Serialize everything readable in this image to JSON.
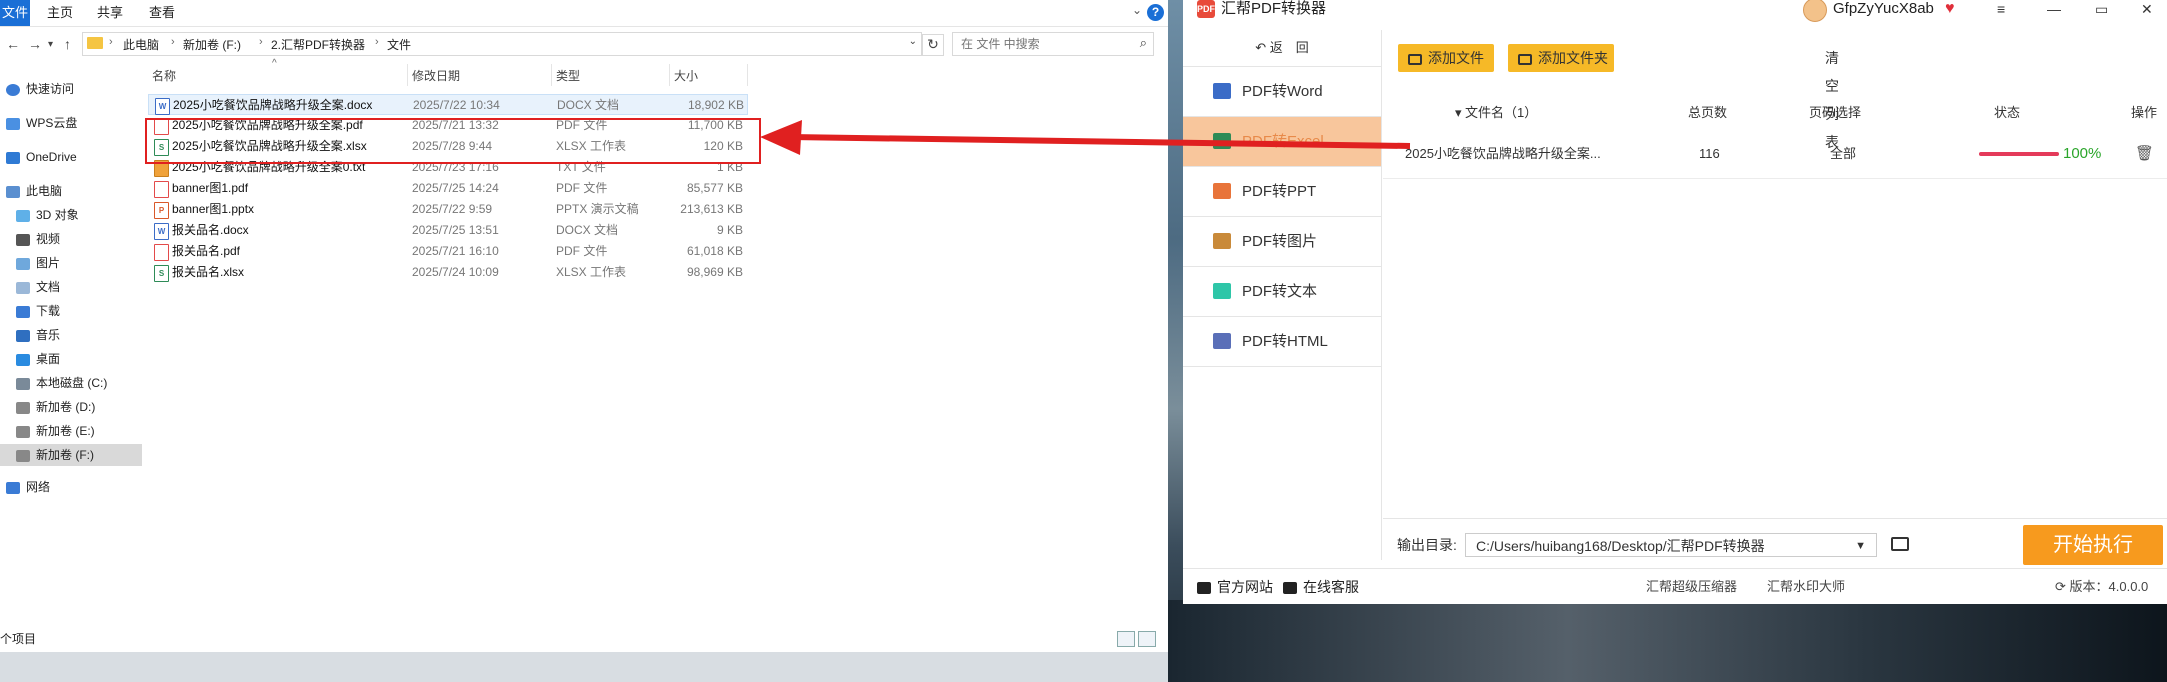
{
  "explorer": {
    "ribbon": {
      "file": "文件",
      "home": "主页",
      "share": "共享",
      "view": "查看"
    },
    "breadcrumbs": [
      "此电脑",
      "新加卷 (F:)",
      "2.汇帮PDF转换器",
      "文件"
    ],
    "search_placeholder": "在 文件 中搜索",
    "nav": {
      "quick_access": "快速访问",
      "wps_cloud": "WPS云盘",
      "onedrive": "OneDrive",
      "this_pc": "此电脑",
      "objects_3d": "3D 对象",
      "videos": "视频",
      "pictures": "图片",
      "documents": "文档",
      "downloads": "下载",
      "music": "音乐",
      "desktop": "桌面",
      "disk_c": "本地磁盘 (C:)",
      "disk_d": "新加卷 (D:)",
      "disk_e": "新加卷 (E:)",
      "disk_f": "新加卷 (F:)",
      "network": "网络"
    },
    "columns": {
      "name": "名称",
      "date": "修改日期",
      "type": "类型",
      "size": "大小"
    },
    "files": [
      {
        "name": "2025小吃餐饮品牌战略升级全案.docx",
        "date": "2025/7/22 10:34",
        "type": "DOCX 文档",
        "size": "18,902 KB",
        "icon": "docx"
      },
      {
        "name": "2025小吃餐饮品牌战略升级全案.pdf",
        "date": "2025/7/21 13:32",
        "type": "PDF 文件",
        "size": "11,700 KB",
        "icon": "pdf"
      },
      {
        "name": "2025小吃餐饮品牌战略升级全案.xlsx",
        "date": "2025/7/28 9:44",
        "type": "XLSX 工作表",
        "size": "120 KB",
        "icon": "xlsx"
      },
      {
        "name": "2025小吃餐饮品牌战略升级全案0.txt",
        "date": "2025/7/23 17:16",
        "type": "TXT 文件",
        "size": "1 KB",
        "icon": "txt"
      },
      {
        "name": "banner图1.pdf",
        "date": "2025/7/25 14:24",
        "type": "PDF 文件",
        "size": "85,577 KB",
        "icon": "pdf"
      },
      {
        "name": "banner图1.pptx",
        "date": "2025/7/22 9:59",
        "type": "PPTX 演示文稿",
        "size": "213,613 KB",
        "icon": "pptx"
      },
      {
        "name": "报关品名.docx",
        "date": "2025/7/25 13:51",
        "type": "DOCX 文档",
        "size": "9 KB",
        "icon": "docx"
      },
      {
        "name": "报关品名.pdf",
        "date": "2025/7/21 16:10",
        "type": "PDF 文件",
        "size": "61,018 KB",
        "icon": "pdf"
      },
      {
        "name": "报关品名.xlsx",
        "date": "2025/7/24 10:09",
        "type": "XLSX 工作表",
        "size": "98,969 KB",
        "icon": "xlsx"
      }
    ],
    "status": "个项目"
  },
  "app": {
    "title": "汇帮PDF转换器",
    "logo_text": "PDF",
    "user_name": "GfpZyYucX8ab",
    "back": "返　回",
    "menu": [
      {
        "label": "PDF转Word",
        "icon_color": "#3b6cc7"
      },
      {
        "label": "PDF转Excel",
        "icon_color": "#2e8b57"
      },
      {
        "label": "PDF转PPT",
        "icon_color": "#e8743a"
      },
      {
        "label": "PDF转图片",
        "icon_color": "#c98a3a"
      },
      {
        "label": "PDF转文本",
        "icon_color": "#2ec6a8"
      },
      {
        "label": "PDF转HTML",
        "icon_color": "#5a6fb8"
      }
    ],
    "toolbar": {
      "add_file": "添加文件",
      "add_folder": "添加文件夹",
      "clear": "清空列表"
    },
    "table_header": {
      "filename": "文件名（1）",
      "pages": "总页数",
      "page_select": "页码选择",
      "status": "状态",
      "action": "操作"
    },
    "task": {
      "filename": "2025小吃餐饮品牌战略升级全案...",
      "pages": "116",
      "page_select": "全部",
      "progress": 100,
      "progress_text": "100%"
    },
    "output": {
      "label": "输出目录:",
      "path": "C:/Users/huibang168/Desktop/汇帮PDF转换器"
    },
    "start": "开始执行",
    "footer": {
      "website": "官方网站",
      "support": "在线客服",
      "compressor": "汇帮超级压缩器",
      "watermark": "汇帮水印大师",
      "version": "版本：4.0.0.0"
    },
    "colors": {
      "accent": "#f6b927",
      "start": "#f79a1e",
      "active_menu": "#f8c69c",
      "progress": "#e43a5a",
      "success_text": "#2aa52a",
      "annotation": "#e02020"
    }
  }
}
